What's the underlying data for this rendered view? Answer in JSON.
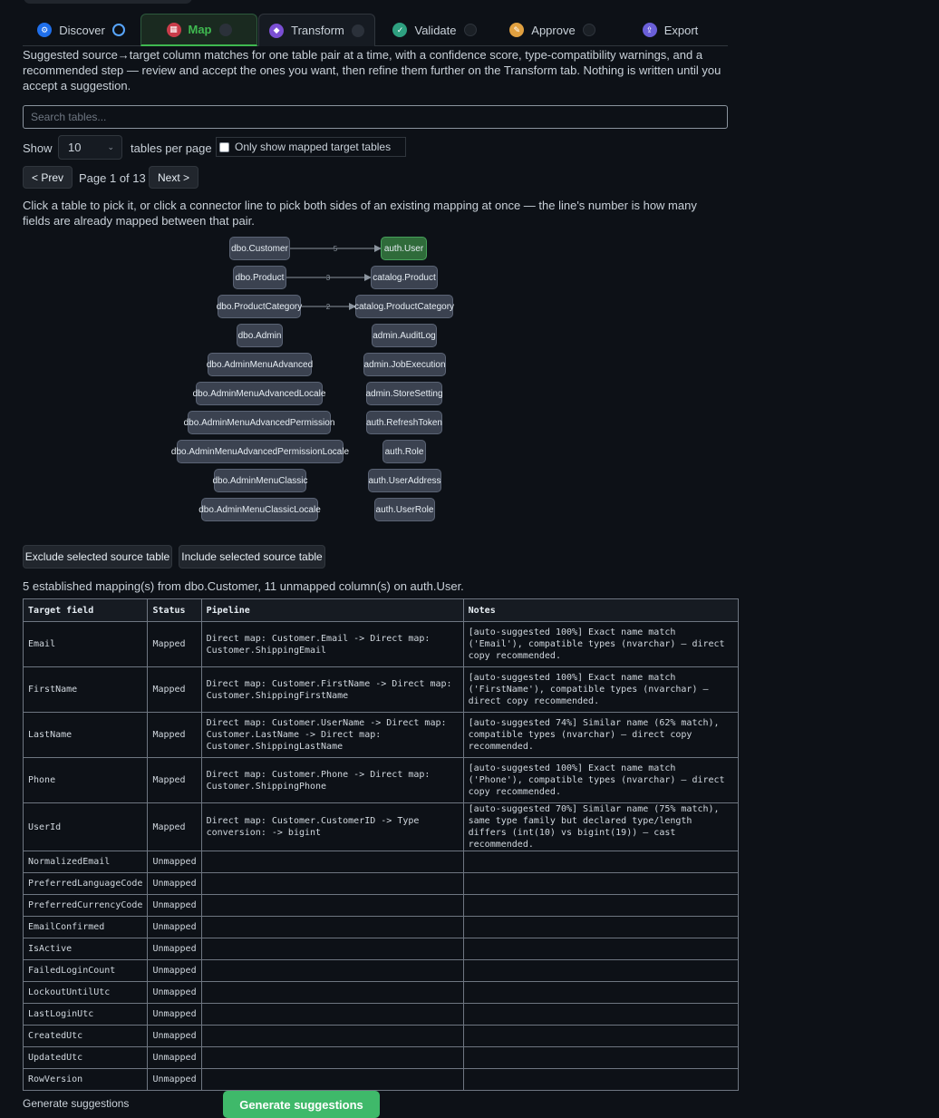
{
  "tabs": [
    {
      "label": "Discover",
      "icon": "discover-icon",
      "status": "in-progress"
    },
    {
      "label": "Map",
      "icon": "map-icon",
      "status": "active"
    },
    {
      "label": "Transform",
      "icon": "transform-icon",
      "status": "pending"
    },
    {
      "label": "Validate",
      "icon": "validate-icon",
      "status": "pending"
    },
    {
      "label": "Approve",
      "icon": "approve-icon",
      "status": "pending"
    },
    {
      "label": "Export",
      "icon": "export-icon",
      "status": "none"
    }
  ],
  "description": "Suggested source→target column matches for one table pair at a time, with a confidence score, type-compatibility warnings, and a recommended step — review and accept the ones you want, then refine them further on the Transform tab. Nothing is written until you accept a suggestion.",
  "search": {
    "placeholder": "Search tables..."
  },
  "paging": {
    "show_label": "Show",
    "per_page": "10",
    "per_page_suffix": "tables per page",
    "only_mapped_label": "Only show mapped target tables",
    "prev_label": "< Prev",
    "page_info": "Page 1 of 13",
    "next_label": "Next >"
  },
  "hint": "Click a table to pick it, or click a connector line to pick both sides of an existing mapping at once — the line's number is how many fields are already mapped between that pair.",
  "graph": {
    "source_tables": [
      "dbo.Customer",
      "dbo.Product",
      "dbo.ProductCategory",
      "dbo.Admin",
      "dbo.AdminMenuAdvanced",
      "dbo.AdminMenuAdvancedLocale",
      "dbo.AdminMenuAdvancedPermission",
      "dbo.AdminMenuAdvancedPermissionLocale",
      "dbo.AdminMenuClassic",
      "dbo.AdminMenuClassicLocale"
    ],
    "target_tables": [
      "auth.User",
      "catalog.Product",
      "catalog.ProductCategory",
      "admin.AuditLog",
      "admin.JobExecution",
      "admin.StoreSetting",
      "auth.RefreshToken",
      "auth.Role",
      "auth.UserAddress",
      "auth.UserRole"
    ],
    "connectors": [
      {
        "source": "dbo.Customer",
        "target": "auth.User",
        "count": "5"
      },
      {
        "source": "dbo.Product",
        "target": "catalog.Product",
        "count": "3"
      },
      {
        "source": "dbo.ProductCategory",
        "target": "catalog.ProductCategory",
        "count": "2"
      }
    ],
    "selected_target": "auth.User"
  },
  "actions": {
    "exclude_label": "Exclude selected source table",
    "include_label": "Include selected source table"
  },
  "status_line": "5 established mapping(s) from dbo.Customer, 11 unmapped column(s) on auth.User.",
  "table": {
    "headers": [
      "Target field",
      "Status",
      "Pipeline",
      "Notes"
    ],
    "rows": [
      {
        "field": "Email",
        "status": "Mapped",
        "pipeline": "Direct map: Customer.Email -> Direct map: Customer.ShippingEmail",
        "notes": "[auto-suggested 100%] Exact name match ('Email'), compatible types (nvarchar) — direct copy recommended."
      },
      {
        "field": "FirstName",
        "status": "Mapped",
        "pipeline": "Direct map: Customer.FirstName -> Direct map: Customer.ShippingFirstName",
        "notes": "[auto-suggested 100%] Exact name match ('FirstName'), compatible types (nvarchar) — direct copy recommended."
      },
      {
        "field": "LastName",
        "status": "Mapped",
        "pipeline": "Direct map: Customer.UserName -> Direct map: Customer.LastName -> Direct map: Customer.ShippingLastName",
        "notes": "[auto-suggested 74%] Similar name (62% match), compatible types (nvarchar) — direct copy recommended."
      },
      {
        "field": "Phone",
        "status": "Mapped",
        "pipeline": "Direct map: Customer.Phone -> Direct map: Customer.ShippingPhone",
        "notes": "[auto-suggested 100%] Exact name match ('Phone'), compatible types (nvarchar) — direct copy recommended."
      },
      {
        "field": "UserId",
        "status": "Mapped",
        "pipeline": "Direct map: Customer.CustomerID -> Type conversion: -> bigint",
        "notes": "[auto-suggested 70%] Similar name (75% match), same type family but declared type/length differs (int(10) vs bigint(19)) — cast recommended."
      },
      {
        "field": "NormalizedEmail",
        "status": "Unmapped",
        "pipeline": "",
        "notes": ""
      },
      {
        "field": "PreferredLanguageCode",
        "status": "Unmapped",
        "pipeline": "",
        "notes": ""
      },
      {
        "field": "PreferredCurrencyCode",
        "status": "Unmapped",
        "pipeline": "",
        "notes": ""
      },
      {
        "field": "EmailConfirmed",
        "status": "Unmapped",
        "pipeline": "",
        "notes": ""
      },
      {
        "field": "IsActive",
        "status": "Unmapped",
        "pipeline": "",
        "notes": ""
      },
      {
        "field": "FailedLoginCount",
        "status": "Unmapped",
        "pipeline": "",
        "notes": ""
      },
      {
        "field": "LockoutUntilUtc",
        "status": "Unmapped",
        "pipeline": "",
        "notes": ""
      },
      {
        "field": "LastLoginUtc",
        "status": "Unmapped",
        "pipeline": "",
        "notes": ""
      },
      {
        "field": "CreatedUtc",
        "status": "Unmapped",
        "pipeline": "",
        "notes": ""
      },
      {
        "field": "UpdatedUtc",
        "status": "Unmapped",
        "pipeline": "",
        "notes": ""
      },
      {
        "field": "RowVersion",
        "status": "Unmapped",
        "pipeline": "",
        "notes": ""
      }
    ]
  },
  "footer": {
    "label": "Generate suggestions",
    "button_label": "Generate suggestions"
  },
  "colors": {
    "accent": "#3fb950",
    "button_green": "#3fb96a",
    "background": "#0d1117"
  }
}
